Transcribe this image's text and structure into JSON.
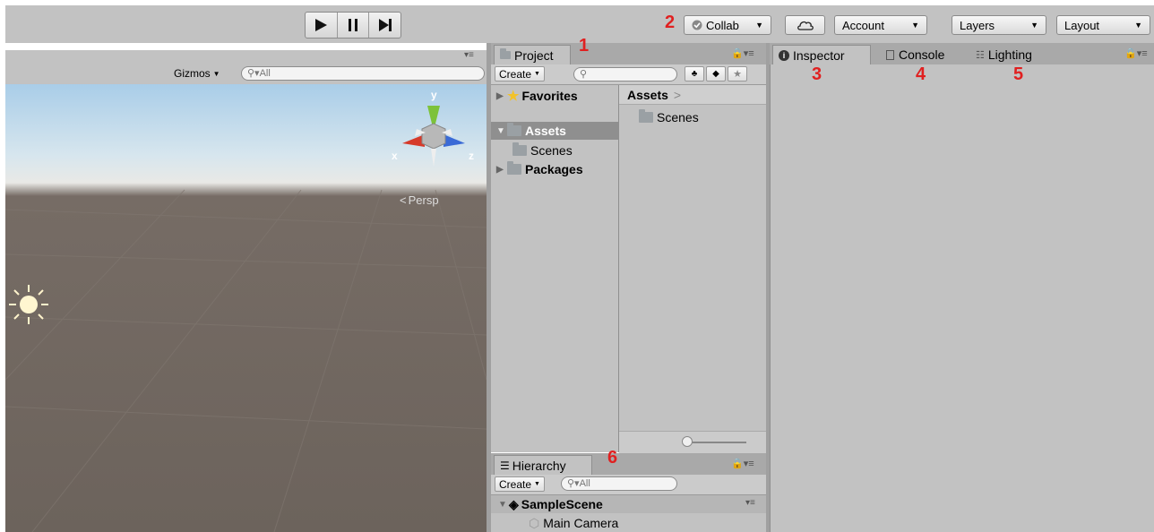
{
  "toolbar": {
    "play_icon": "play-icon",
    "pause_icon": "pause-icon",
    "step_icon": "step-icon",
    "collab_label": "Collab",
    "account_label": "Account",
    "layers_label": "Layers",
    "layout_label": "Layout"
  },
  "annotations": {
    "n1": "1",
    "n2": "2",
    "n3": "3",
    "n4": "4",
    "n5": "5",
    "n6": "6"
  },
  "scene": {
    "gizmos_label": "Gizmos",
    "search_placeholder": "All",
    "persp_label": "Persp",
    "axis_y": "y",
    "axis_x": "x",
    "axis_z": "z"
  },
  "project": {
    "tab_label": "Project",
    "create_label": "Create",
    "favorites_label": "Favorites",
    "assets_label": "Assets",
    "scenes_label": "Scenes",
    "packages_label": "Packages",
    "breadcrumb": "Assets",
    "breadcrumb_sep": ">",
    "grid_item": "Scenes"
  },
  "hierarchy": {
    "tab_label": "Hierarchy",
    "create_label": "Create",
    "search_placeholder": "All",
    "scene_name": "SampleScene",
    "child_item": "Main Camera"
  },
  "inspector": {
    "tabs": [
      {
        "label": "Inspector"
      },
      {
        "label": "Console"
      },
      {
        "label": "Lighting"
      }
    ]
  },
  "colors": {
    "panel_bg": "#c2c2c2",
    "tab_strip": "#a9a9a9",
    "annotation_red": "#e02020",
    "ground": "#6c635c",
    "sky": "#a9cde8"
  }
}
